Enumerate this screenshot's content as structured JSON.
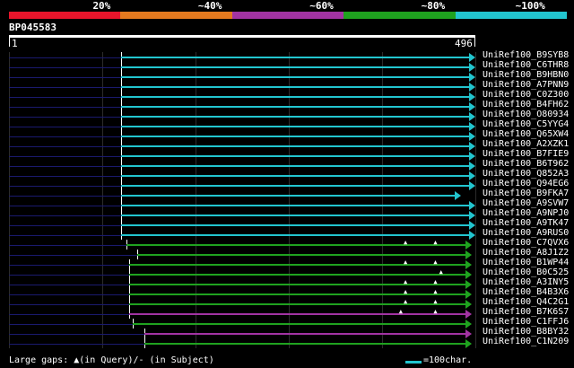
{
  "scale": {
    "labels": [
      "20%",
      "~40%",
      "~60%",
      "~80%",
      "~100%"
    ],
    "colors": [
      "#e8152b",
      "#e57a1f",
      "#a233a3",
      "#1fa21f",
      "#22c5cf"
    ]
  },
  "query": {
    "name": "BP045583",
    "start": "1",
    "end": "496",
    "length": 496
  },
  "palette": {
    "cyan": "#22c5cf",
    "green": "#1fa21f",
    "magenta": "#a233a3",
    "tick": "#ffffff",
    "lead": "#1a1a6e"
  },
  "hits": [
    {
      "id": "UniRef100_B9SYB8",
      "color": "cyan",
      "start": 120,
      "end": 496,
      "gaps": []
    },
    {
      "id": "UniRef100_C6THR8",
      "color": "cyan",
      "start": 120,
      "end": 496,
      "gaps": []
    },
    {
      "id": "UniRef100_B9HBN0",
      "color": "cyan",
      "start": 120,
      "end": 496,
      "gaps": []
    },
    {
      "id": "UniRef100_A7PNN9",
      "color": "cyan",
      "start": 120,
      "end": 496,
      "gaps": []
    },
    {
      "id": "UniRef100_C0Z300",
      "color": "cyan",
      "start": 120,
      "end": 496,
      "gaps": []
    },
    {
      "id": "UniRef100_B4FH62",
      "color": "cyan",
      "start": 120,
      "end": 496,
      "gaps": []
    },
    {
      "id": "UniRef100_O80934",
      "color": "cyan",
      "start": 120,
      "end": 496,
      "gaps": []
    },
    {
      "id": "UniRef100_C5YYG4",
      "color": "cyan",
      "start": 120,
      "end": 496,
      "gaps": []
    },
    {
      "id": "UniRef100_Q65XW4",
      "color": "cyan",
      "start": 120,
      "end": 496,
      "gaps": []
    },
    {
      "id": "UniRef100_A2XZK1",
      "color": "cyan",
      "start": 120,
      "end": 496,
      "gaps": []
    },
    {
      "id": "UniRef100_B7FIE9",
      "color": "cyan",
      "start": 120,
      "end": 496,
      "gaps": []
    },
    {
      "id": "UniRef100_B6T962",
      "color": "cyan",
      "start": 120,
      "end": 496,
      "gaps": []
    },
    {
      "id": "UniRef100_Q852A3",
      "color": "cyan",
      "start": 120,
      "end": 496,
      "gaps": []
    },
    {
      "id": "UniRef100_Q94EG6",
      "color": "cyan",
      "start": 120,
      "end": 496,
      "gaps": []
    },
    {
      "id": "UniRef100_B9FKA7",
      "color": "cyan",
      "start": 120,
      "end": 481,
      "gaps": []
    },
    {
      "id": "UniRef100_A9SVW7",
      "color": "cyan",
      "start": 120,
      "end": 496,
      "gaps": []
    },
    {
      "id": "UniRef100_A9NPJ0",
      "color": "cyan",
      "start": 120,
      "end": 496,
      "gaps": []
    },
    {
      "id": "UniRef100_A9TK47",
      "color": "cyan",
      "start": 120,
      "end": 496,
      "gaps": []
    },
    {
      "id": "UniRef100_A9RUS0",
      "color": "cyan",
      "start": 120,
      "end": 496,
      "gaps": []
    },
    {
      "id": "UniRef100_C7QVX6",
      "color": "green",
      "start": 126,
      "end": 492,
      "gaps": [
        425,
        457
      ]
    },
    {
      "id": "UniRef100_A8J1Z2",
      "color": "green",
      "start": 137,
      "end": 492,
      "gaps": []
    },
    {
      "id": "UniRef100_B1WP44",
      "color": "green",
      "start": 129,
      "end": 492,
      "gaps": [
        425,
        457
      ]
    },
    {
      "id": "UniRef100_B0C525",
      "color": "green",
      "start": 129,
      "end": 492,
      "gaps": [
        463
      ]
    },
    {
      "id": "UniRef100_A3INY5",
      "color": "green",
      "start": 129,
      "end": 492,
      "gaps": [
        425,
        457
      ]
    },
    {
      "id": "UniRef100_B4B3X6",
      "color": "green",
      "start": 129,
      "end": 492,
      "gaps": [
        425,
        457
      ]
    },
    {
      "id": "UniRef100_Q4C2G1",
      "color": "green",
      "start": 129,
      "end": 492,
      "gaps": [
        425,
        457
      ]
    },
    {
      "id": "UniRef100_B7K6S7",
      "color": "magenta",
      "start": 129,
      "end": 492,
      "gaps": [
        420,
        457
      ]
    },
    {
      "id": "UniRef100_C1FFJ6",
      "color": "green",
      "start": 132,
      "end": 492,
      "gaps": []
    },
    {
      "id": "UniRef100_B8BY32",
      "color": "magenta",
      "start": 145,
      "end": 492,
      "gaps": []
    },
    {
      "id": "UniRef100_C1N209",
      "color": "green",
      "start": 145,
      "end": 492,
      "gaps": []
    }
  ],
  "footer": {
    "text": "Large gaps: ▲(in Query)/- (in Subject)",
    "legend": "=100char."
  }
}
